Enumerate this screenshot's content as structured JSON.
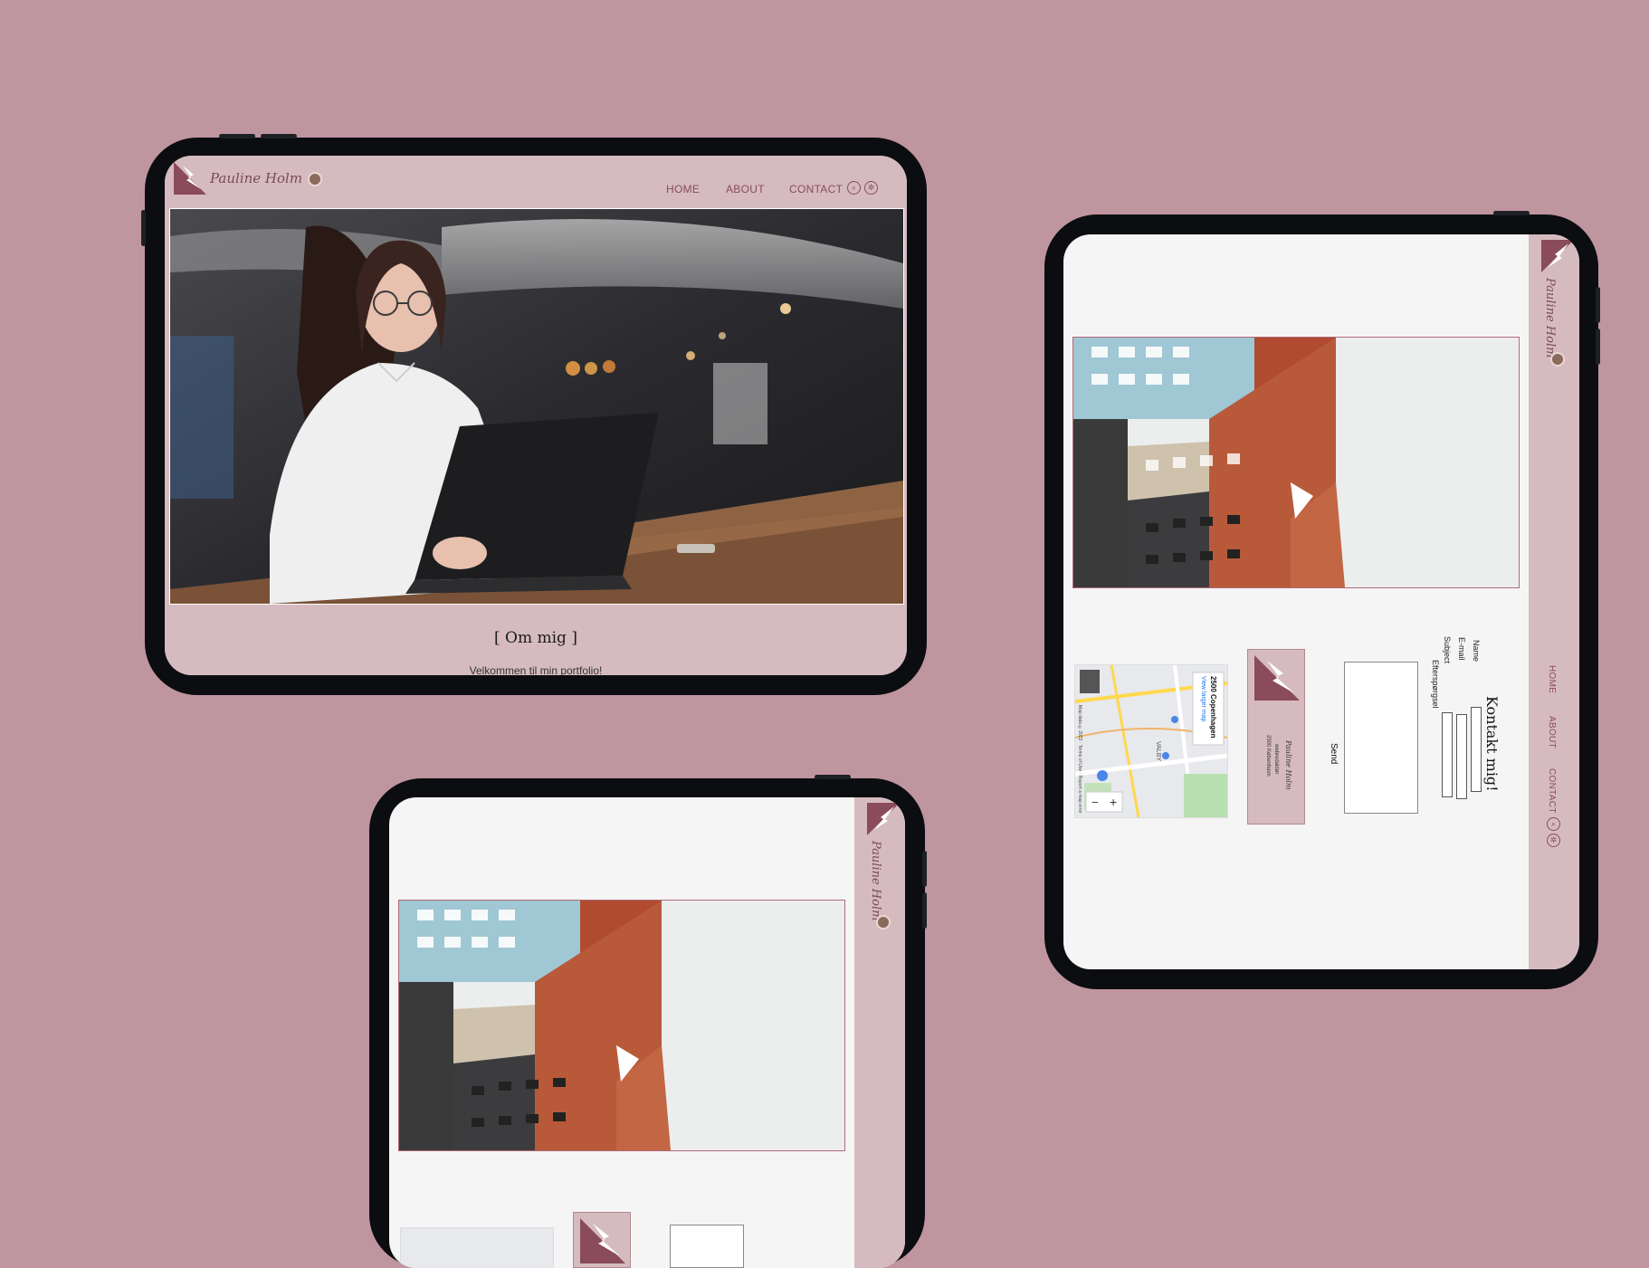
{
  "brand": {
    "name": "Pauline Holm",
    "accent": "#8a4b5a",
    "background": "#bf959f",
    "panel": "#d5bbbf"
  },
  "tablet_a": {
    "nav": {
      "home": "HOME",
      "about": "ABOUT",
      "contact": "CONTACT"
    },
    "icons": [
      "search-icon",
      "settings-icon"
    ],
    "about_title": "[ Om mig ]",
    "welcome_text": "Velkommen til min portfolio!"
  },
  "tablet_b": {
    "nav": {
      "home": "HOME",
      "about": "ABOUT",
      "contact": "CONTACT"
    },
    "contact_title": "Kontakt mig!",
    "form": {
      "name_label": "Name",
      "email_label": "E-mail",
      "subject_label": "Subject",
      "message_label": "Efterspørgsel",
      "send_label": "Send"
    },
    "card": {
      "line1": "Pauline Holm",
      "line2": "webredaktør",
      "line3": "2500 København"
    },
    "map": {
      "place": "2500 Copenhagen",
      "link": "View larger map",
      "district": "VALBY",
      "attribution": "Map data ©2022 · Terms of Use · Report a map error",
      "zoom_out": "−",
      "zoom_in": "+"
    }
  }
}
